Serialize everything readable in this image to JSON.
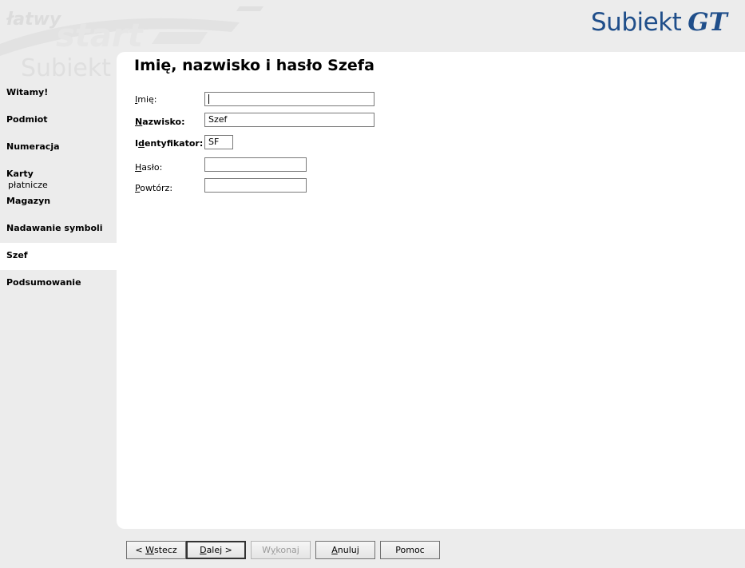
{
  "watermark": {
    "latwy": "łatwy",
    "start": "start",
    "subiekt": "Subiekt"
  },
  "logo": {
    "text": "Subiekt",
    "gt": "GT",
    "color": "#1f4e8a"
  },
  "nav": {
    "items": [
      {
        "label": "Witamy!"
      },
      {
        "label": "Podmiot"
      },
      {
        "label": "Numeracja"
      },
      {
        "label": "Karty",
        "sublabel": "płatnicze"
      },
      {
        "label": "Magazyn"
      },
      {
        "label": "Nadawanie symboli"
      },
      {
        "label": "Szef",
        "active": true
      },
      {
        "label": "Podsumowanie"
      }
    ]
  },
  "page": {
    "title": "Imię, nazwisko i hasło Szefa"
  },
  "form": {
    "imie": {
      "label_u": "I",
      "label_rest": "mię:",
      "value": ""
    },
    "nazwisko": {
      "label_u": "N",
      "label_rest": "azwisko:",
      "value": "Szef"
    },
    "identyfikator": {
      "label_pre": "I",
      "label_u": "d",
      "label_rest": "entyfikator:",
      "value": "SF"
    },
    "haslo": {
      "label_u": "H",
      "label_rest": "asło:",
      "value": ""
    },
    "powtorz": {
      "label_u": "P",
      "label_rest": "owtórz:",
      "value": ""
    }
  },
  "buttons": {
    "back_pre": "< ",
    "back_u": "W",
    "back_rest": "stecz",
    "next_u": "D",
    "next_rest": "alej >",
    "finish_pre": "W",
    "finish_u": "y",
    "finish_rest": "konaj",
    "cancel_u": "A",
    "cancel_rest": "nuluj",
    "help": "Pomoc"
  }
}
